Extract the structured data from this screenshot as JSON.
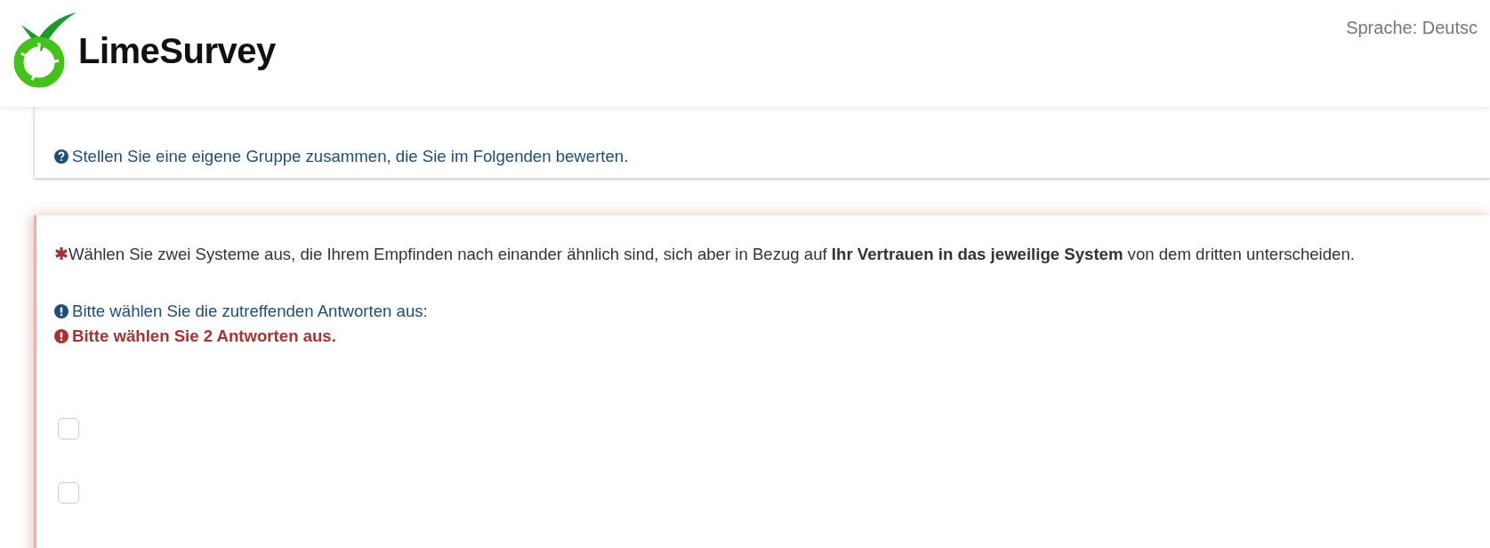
{
  "header": {
    "logo_text": "LimeSurvey",
    "language": "Sprache: Deutsc"
  },
  "group": {
    "description": "Stellen Sie eine eigene Gruppe zusammen, die Sie im Folgenden bewerten."
  },
  "question": {
    "mandatory": true,
    "text": "Wählen Sie zwei Systeme aus, die Ihrem Empfinden nach einander ähnlich sind, sich aber in Bezug auf **Ihr Vertrauen in das jeweilige System** von dem dritten unterscheiden.",
    "tips": [
      {
        "kind": "info",
        "text": "Bitte wählen Sie die zutreffenden Antworten aus:"
      },
      {
        "kind": "error",
        "text": "Bitte wählen Sie 2 Antworten aus."
      }
    ],
    "options": [
      {
        "checked": false
      },
      {
        "checked": false
      }
    ]
  }
}
